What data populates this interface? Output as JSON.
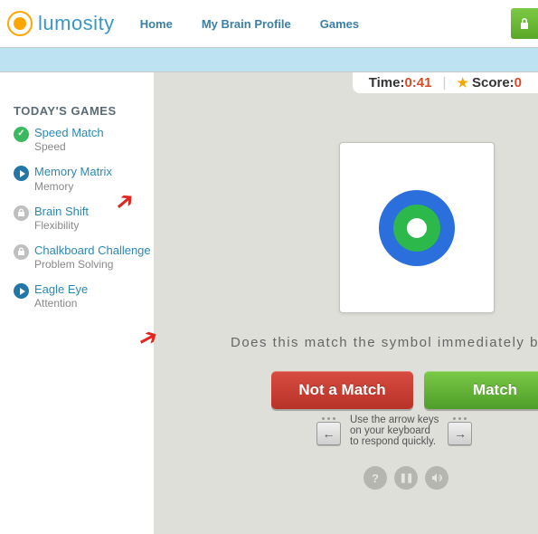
{
  "brand": "lumosity",
  "nav": {
    "home": "Home",
    "brain": "My Brain Profile",
    "games": "Games"
  },
  "sidebar_title": "TODAY'S GAMES",
  "games": [
    {
      "name": "Speed Match",
      "cat": "Speed"
    },
    {
      "name": "Memory Matrix",
      "cat": "Memory"
    },
    {
      "name": "Brain Shift",
      "cat": "Flexibility"
    },
    {
      "name": "Chalkboard Challenge",
      "cat": "Problem Solving"
    },
    {
      "name": "Eagle Eye",
      "cat": "Attention"
    }
  ],
  "hud": {
    "time_label": "Time: ",
    "time": "0:41",
    "score_label": "Score: ",
    "score": "0"
  },
  "question": "Does this match the symbol immediately be",
  "buttons": {
    "no": "Not a Match",
    "yes": "Match"
  },
  "hint": "Use the arrow keys\non your keyboard\nto respond quickly.",
  "keys": {
    "left": "←",
    "right": "→"
  },
  "controls": {
    "help": "?",
    "pause": "❚❚"
  },
  "symbol": {
    "outer": "#2a6fdb",
    "mid": "#2cb84a",
    "inner": "#ffffff"
  }
}
